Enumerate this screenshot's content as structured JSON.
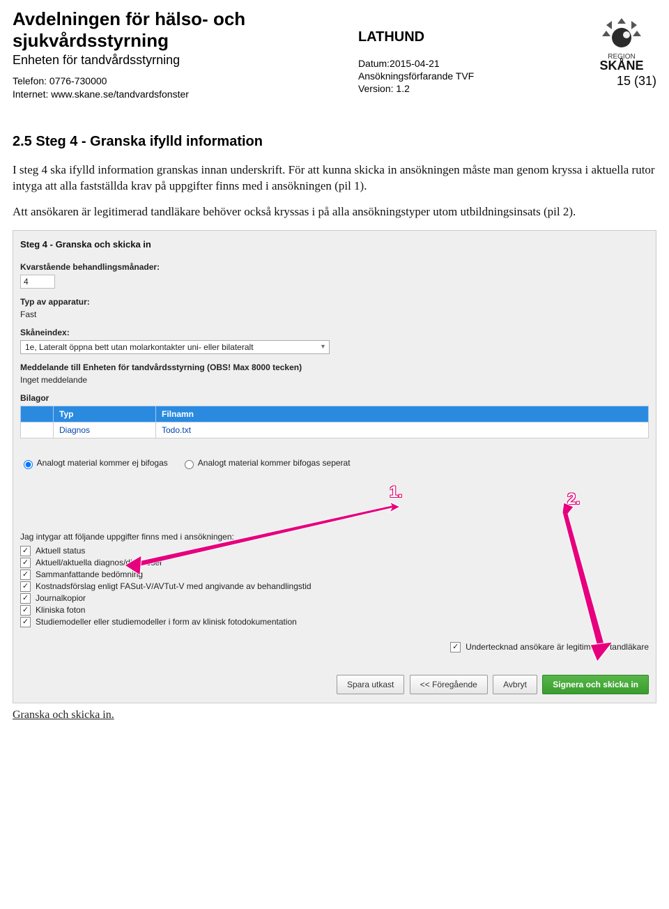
{
  "header": {
    "title_line1": "Avdelningen för hälso- och",
    "title_line2": "sjukvårdsstyrning",
    "subtitle": "Enheten för tandvårdsstyrning",
    "phone_label": "Telefon: 0776-730000",
    "internet_label": "Internet: www.skane.se/tandvardsfonster",
    "doc_type": "LATHUND",
    "date": "Datum:2015-04-21",
    "ref": "Ansökningsförfarande TVF",
    "version": "Version: 1.2",
    "page_num": "15 (31)",
    "logo_alt": "Region Skåne"
  },
  "section": {
    "heading": "2.5   Steg 4 - Granska ifylld information",
    "para1": "I steg 4 ska ifylld information granskas innan underskrift. För att kunna skicka in ansökningen måste man genom kryssa i aktuella rutor intyga att alla fastställda krav på uppgifter finns med i ansökningen (pil 1).",
    "para2": "Att ansökaren är legitimerad tandläkare behöver också kryssas i på alla ansökningstyper utom utbildningsinsats (pil 2)."
  },
  "pane": {
    "title": "Steg 4 - Granska och skicka in",
    "kvar_label": "Kvarstående behandlingsmånader:",
    "kvar_value": "4",
    "typ_label": "Typ av apparatur:",
    "typ_value": "Fast",
    "index_label": "Skåneindex:",
    "index_value": "1e, Lateralt öppna bett utan molarkontakter uni- eller bilateralt",
    "meddelande_label": "Meddelande till Enheten för tandvårdsstyrning (OBS! Max 8000 tecken)",
    "meddelande_value": "Inget meddelande",
    "bilagor_label": "Bilagor",
    "bilagor_cols": {
      "typ": "Typ",
      "filnamn": "Filnamn"
    },
    "bilagor_row": {
      "typ": "Diagnos",
      "filnamn": "Todo.txt"
    },
    "radio1": "Analogt material kommer ej bifogas",
    "radio2": "Analogt material kommer bifogas seperat",
    "intyg_line": "Jag intygar att följande uppgifter finns med i ansökningen:",
    "checks": [
      "Aktuell status",
      "Aktuell/aktuella diagnos/diagnoser",
      "Sammanfattande bedömning",
      "Kostnadsförslag enligt FASut-V/AVTut-V med angivande av behandlingstid",
      "Journalkopior",
      "Kliniska foton",
      "Studiemodeller eller studiemodeller i form av klinisk fotodokumentation"
    ],
    "undertecknad": "Undertecknad ansökare är legitimerad tandläkare",
    "callout1": "1.",
    "callout2": "2.",
    "buttons": {
      "spara": "Spara utkast",
      "foregaende": "<< Föregående",
      "avbryt": "Avbryt",
      "signera": "Signera och skicka in"
    }
  },
  "footer_note": "Granska och skicka in."
}
